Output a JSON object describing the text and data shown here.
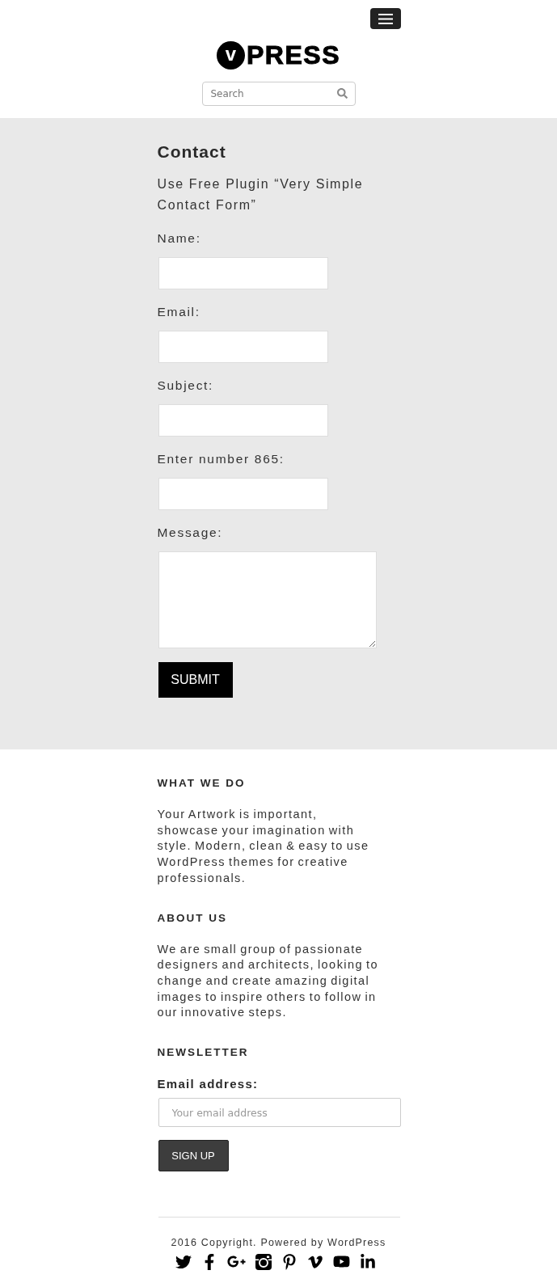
{
  "header": {
    "logo": {
      "badge": "v",
      "text": "PRESS"
    },
    "search": {
      "placeholder": "Search"
    }
  },
  "contact": {
    "title": "Contact",
    "intro": "Use Free Plugin “Very Simple Contact Form”",
    "fields": [
      {
        "kind": "text",
        "label": "Name:"
      },
      {
        "kind": "text",
        "label": "Email:"
      },
      {
        "kind": "text",
        "label": "Subject:"
      },
      {
        "kind": "text",
        "label": "Enter number 865:"
      },
      {
        "kind": "textarea",
        "label": "Message:"
      }
    ],
    "submit": "SUBMIT"
  },
  "footer": {
    "widgets": [
      {
        "heading": "WHAT WE DO",
        "text": "Your Artwork is important, showcase your imagination with style. Modern, clean & easy to use WordPress themes for creative professionals."
      },
      {
        "heading": "ABOUT US",
        "text": "We are small group of passionate designers and architects, looking to change and create amazing digital images to inspire others to follow in our innovative steps."
      }
    ],
    "newsletter": {
      "heading": "NEWSLETTER",
      "label": "Email address:",
      "placeholder": "Your email address",
      "button": "SIGN UP"
    },
    "copyright": "2016 Copyright. Powered by WordPress"
  }
}
